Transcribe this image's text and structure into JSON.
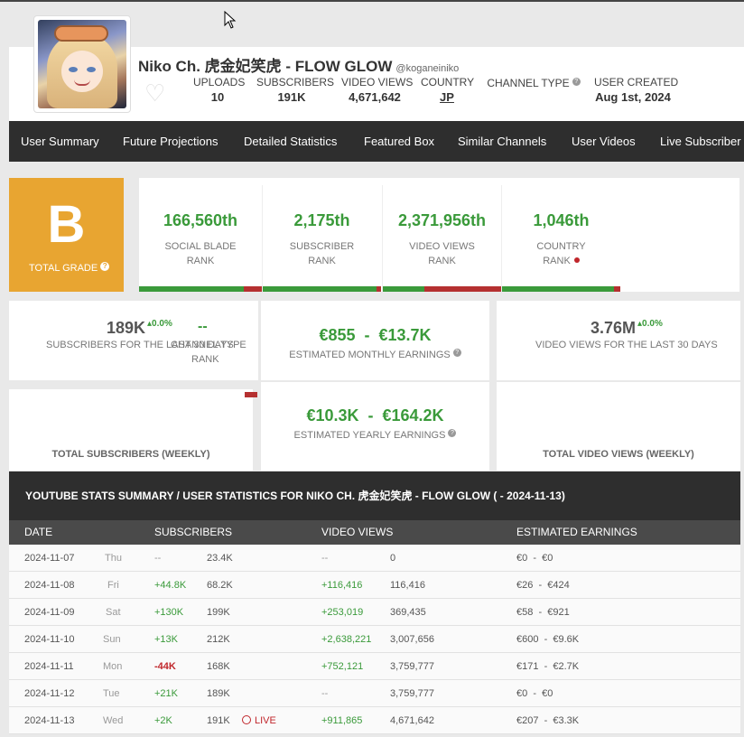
{
  "channel": {
    "name": "Niko Ch. 虎金妃笑虎 - FLOW GLOW",
    "handle": "@koganeiniko"
  },
  "header_stats": [
    {
      "label": "UPLOADS",
      "value": "10"
    },
    {
      "label": "SUBSCRIBERS",
      "value": "191K"
    },
    {
      "label": "VIDEO VIEWS",
      "value": "4,671,642"
    },
    {
      "label": "COUNTRY",
      "value": "JP"
    },
    {
      "label": "CHANNEL TYPE",
      "value": ""
    },
    {
      "label": "USER CREATED",
      "value": "Aug 1st, 2024"
    }
  ],
  "nav": [
    "User Summary",
    "Future Projections",
    "Detailed Statistics",
    "Featured Box",
    "Similar Channels",
    "User Videos",
    "Live Subscriber"
  ],
  "grade": {
    "letter": "B",
    "label": "TOTAL GRADE"
  },
  "ranks": [
    {
      "value": "166,560th",
      "line1": "SOCIAL BLADE",
      "line2": "RANK",
      "red_fraction": 0.15
    },
    {
      "value": "2,175th",
      "line1": "SUBSCRIBER",
      "line2": "RANK",
      "red_fraction": 0.04
    },
    {
      "value": "2,371,956th",
      "line1": "VIDEO VIEWS",
      "line2": "RANK",
      "red_fraction": 0.65
    },
    {
      "value": "1,046th",
      "line1": "COUNTRY",
      "line2": "RANK",
      "red_fraction": 0.05
    }
  ],
  "summary": {
    "subs_30": "189K",
    "subs_30_pct": "0.0%",
    "subs_30_label": "SUBSCRIBERS FOR THE LAST 30 DAYS",
    "channel_type_value": "--",
    "channel_type_label": "CHANNEL TYPE",
    "channel_type_rank": "RANK",
    "monthly": "€855  -  €13.7K",
    "monthly_label": "ESTIMATED MONTHLY EARNINGS",
    "views_30": "3.76M",
    "views_30_pct": "0.0%",
    "views_30_label": "VIDEO VIEWS FOR THE LAST 30 DAYS",
    "total_subs_label": "TOTAL SUBSCRIBERS (WEEKLY)",
    "yearly": "€10.3K  -  €164.2K",
    "yearly_label": "ESTIMATED YEARLY EARNINGS",
    "total_views_label": "TOTAL VIDEO VIEWS (WEEKLY)"
  },
  "table": {
    "title": "YOUTUBE STATS SUMMARY / USER STATISTICS FOR NIKO CH. 虎金妃笑虎 - FLOW GLOW ( - 2024-11-13)",
    "columns": [
      "DATE",
      "SUBSCRIBERS",
      "VIDEO VIEWS",
      "ESTIMATED EARNINGS"
    ],
    "rows": [
      {
        "date": "2024-11-07",
        "day": "Thu",
        "sub_change": "--",
        "subs": "23.4K",
        "view_change": "--",
        "views": "0",
        "earnings": "€0  -  €0",
        "live": ""
      },
      {
        "date": "2024-11-08",
        "day": "Fri",
        "sub_change": "+44.8K",
        "subs": "68.2K",
        "view_change": "+116,416",
        "views": "116,416",
        "earnings": "€26  -  €424",
        "live": ""
      },
      {
        "date": "2024-11-09",
        "day": "Sat",
        "sub_change": "+130K",
        "subs": "199K",
        "view_change": "+253,019",
        "views": "369,435",
        "earnings": "€58  -  €921",
        "live": ""
      },
      {
        "date": "2024-11-10",
        "day": "Sun",
        "sub_change": "+13K",
        "subs": "212K",
        "view_change": "+2,638,221",
        "views": "3,007,656",
        "earnings": "€600  -  €9.6K",
        "live": ""
      },
      {
        "date": "2024-11-11",
        "day": "Mon",
        "sub_change": "-44K",
        "subs": "168K",
        "view_change": "+752,121",
        "views": "3,759,777",
        "earnings": "€171  -  €2.7K",
        "live": ""
      },
      {
        "date": "2024-11-12",
        "day": "Tue",
        "sub_change": "+21K",
        "subs": "189K",
        "view_change": "--",
        "views": "3,759,777",
        "earnings": "€0  -  €0",
        "live": ""
      },
      {
        "date": "2024-11-13",
        "day": "Wed",
        "sub_change": "+2K",
        "subs": "191K",
        "view_change": "+911,865",
        "views": "4,671,642",
        "earnings": "€207  -  €3.3K",
        "live": "LIVE"
      }
    ]
  }
}
